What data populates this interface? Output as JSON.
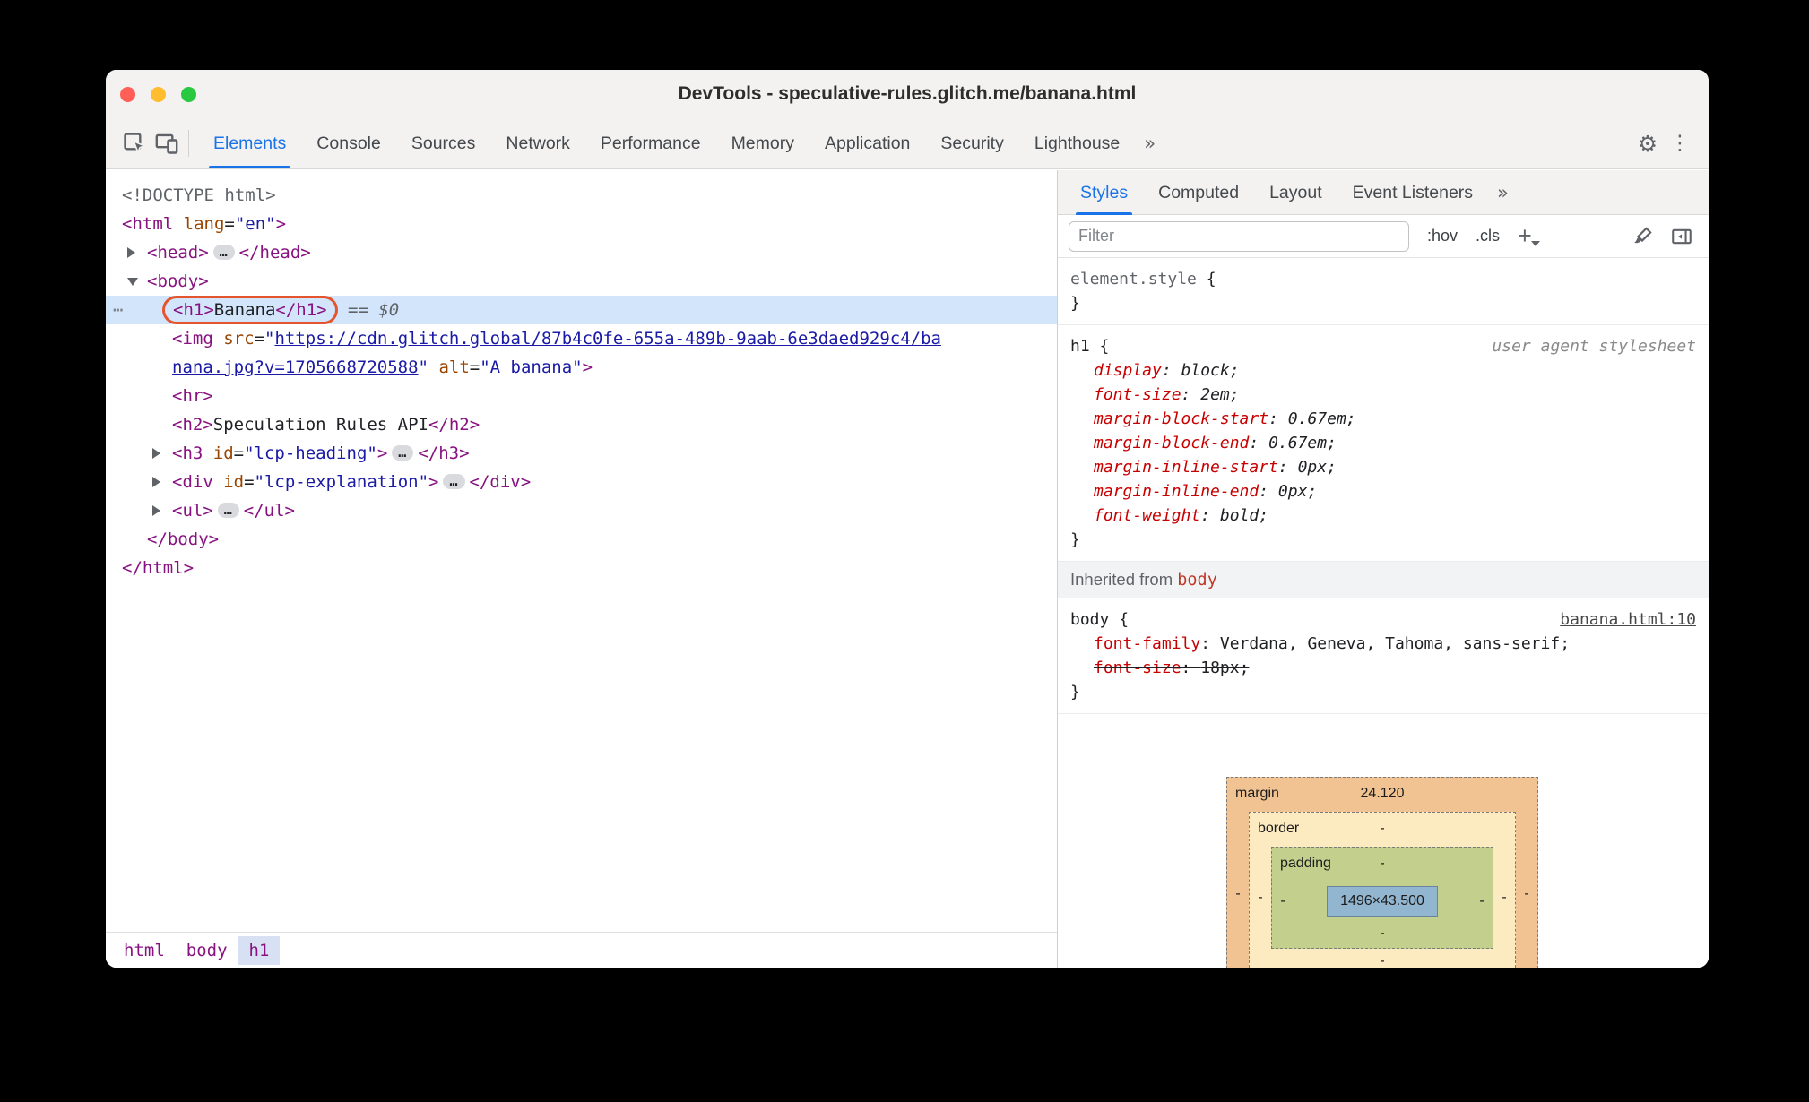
{
  "window": {
    "title": "DevTools - speculative-rules.glitch.me/banana.html"
  },
  "colors": {
    "accent_blue": "#1a73e8",
    "selection_bg": "#d3e5fb",
    "node_highlight_outline": "#e4552d",
    "tag": "#881280",
    "attr_name": "#994500",
    "attr_value": "#1a1aa6",
    "css_property": "#c80000",
    "traffic_close": "#ff5f57",
    "traffic_min": "#febc2e",
    "traffic_zoom": "#28c840"
  },
  "icons": {
    "gear": "⚙",
    "kebab": "⋮",
    "overflow": "»"
  },
  "main_tabs": {
    "items": [
      {
        "label": "Elements",
        "active": true
      },
      {
        "label": "Console"
      },
      {
        "label": "Sources"
      },
      {
        "label": "Network"
      },
      {
        "label": "Performance"
      },
      {
        "label": "Memory"
      },
      {
        "label": "Application"
      },
      {
        "label": "Security"
      },
      {
        "label": "Lighthouse"
      }
    ],
    "overflow": "»"
  },
  "dom": {
    "lines": [
      {
        "indent": 0,
        "tokens": [
          {
            "c": "doctype",
            "t": "<!DOCTYPE html>"
          }
        ]
      },
      {
        "indent": 0,
        "tokens": [
          {
            "c": "tag",
            "t": "<html"
          },
          {
            "c": "attr",
            "t": " lang"
          },
          {
            "c": "plain",
            "t": "="
          },
          {
            "c": "val",
            "t": "\"en\""
          },
          {
            "c": "tag",
            "t": ">"
          }
        ]
      },
      {
        "indent": 1,
        "arrow": "right",
        "tokens": [
          {
            "c": "tag",
            "t": "<head>"
          },
          {
            "c": "pill",
            "t": "…"
          },
          {
            "c": "tag",
            "t": "</head>"
          }
        ]
      },
      {
        "indent": 1,
        "arrow": "down",
        "tokens": [
          {
            "c": "tag",
            "t": "<body>"
          }
        ]
      },
      {
        "indent": 2,
        "selected": true,
        "gutter": "⋯",
        "tokens": [
          {
            "c": "outline",
            "tokens": [
              {
                "c": "tag",
                "t": "<h1>"
              },
              {
                "c": "plain",
                "t": "Banana"
              },
              {
                "c": "tag",
                "t": "</h1>"
              }
            ]
          },
          {
            "c": "marker",
            "t": " == $0"
          }
        ]
      },
      {
        "indent": 2,
        "tokens": [
          {
            "c": "tag",
            "t": "<img"
          },
          {
            "c": "attr",
            "t": " src"
          },
          {
            "c": "plain",
            "t": "="
          },
          {
            "c": "val",
            "t": "\""
          },
          {
            "c": "link",
            "t": "https://cdn.glitch.global/87b4c0fe-655a-489b-9aab-6e3daed929c4/ba"
          }
        ]
      },
      {
        "indent": 2,
        "tokens": [
          {
            "c": "link",
            "t": "nana.jpg?v=1705668720588"
          },
          {
            "c": "val",
            "t": "\""
          },
          {
            "c": "attr",
            "t": " alt"
          },
          {
            "c": "plain",
            "t": "="
          },
          {
            "c": "val",
            "t": "\"A banana\""
          },
          {
            "c": "tag",
            "t": ">"
          }
        ]
      },
      {
        "indent": 2,
        "tokens": [
          {
            "c": "tag",
            "t": "<hr>"
          }
        ]
      },
      {
        "indent": 2,
        "tokens": [
          {
            "c": "tag",
            "t": "<h2>"
          },
          {
            "c": "plain",
            "t": "Speculation Rules API"
          },
          {
            "c": "tag",
            "t": "</h2>"
          }
        ]
      },
      {
        "indent": 2,
        "arrow": "right",
        "tokens": [
          {
            "c": "tag",
            "t": "<h3"
          },
          {
            "c": "attr",
            "t": " id"
          },
          {
            "c": "plain",
            "t": "="
          },
          {
            "c": "val",
            "t": "\"lcp-heading\""
          },
          {
            "c": "tag",
            "t": ">"
          },
          {
            "c": "pill",
            "t": "…"
          },
          {
            "c": "tag",
            "t": "</h3>"
          }
        ]
      },
      {
        "indent": 2,
        "arrow": "right",
        "tokens": [
          {
            "c": "tag",
            "t": "<div"
          },
          {
            "c": "attr",
            "t": " id"
          },
          {
            "c": "plain",
            "t": "="
          },
          {
            "c": "val",
            "t": "\"lcp-explanation\""
          },
          {
            "c": "tag",
            "t": ">"
          },
          {
            "c": "pill",
            "t": "…"
          },
          {
            "c": "tag",
            "t": "</div>"
          }
        ]
      },
      {
        "indent": 2,
        "arrow": "right",
        "tokens": [
          {
            "c": "tag",
            "t": "<ul>"
          },
          {
            "c": "pill",
            "t": "…"
          },
          {
            "c": "tag",
            "t": "</ul>"
          }
        ]
      },
      {
        "indent": 1,
        "tokens": [
          {
            "c": "tag",
            "t": "</body>"
          }
        ]
      },
      {
        "indent": 0,
        "tokens": [
          {
            "c": "tag",
            "t": "</html>"
          }
        ]
      }
    ],
    "breadcrumbs": [
      {
        "label": "html"
      },
      {
        "label": "body"
      },
      {
        "label": "h1",
        "active": true
      }
    ]
  },
  "styles": {
    "tabs": [
      {
        "label": "Styles",
        "active": true
      },
      {
        "label": "Computed"
      },
      {
        "label": "Layout"
      },
      {
        "label": "Event Listeners"
      }
    ],
    "overflow": "»",
    "toolbar": {
      "filter_placeholder": "Filter",
      "pseudo_toggle": ":hov",
      "class_toggle": ".cls",
      "new_rule": "+"
    },
    "syntax": {
      "open": " {",
      "close": "}",
      "colon": ": ",
      "semi": ";"
    },
    "rules": [
      {
        "selector": "element.style",
        "selector_gray": true,
        "props": []
      },
      {
        "selector": "h1",
        "origin": "user agent stylesheet",
        "italic": true,
        "props": [
          {
            "name": "display",
            "value": "block"
          },
          {
            "name": "font-size",
            "value": "2em"
          },
          {
            "name": "margin-block-start",
            "value": "0.67em"
          },
          {
            "name": "margin-block-end",
            "value": "0.67em"
          },
          {
            "name": "margin-inline-start",
            "value": "0px"
          },
          {
            "name": "margin-inline-end",
            "value": "0px"
          },
          {
            "name": "font-weight",
            "value": "bold"
          }
        ]
      },
      {
        "header": "Inherited from ",
        "header_link": "body"
      },
      {
        "selector": "body",
        "source": "banana.html:10",
        "props": [
          {
            "name": "font-family",
            "value": "Verdana, Geneva, Tahoma, sans-serif"
          },
          {
            "name": "font-size",
            "value": "18px",
            "struck": true
          }
        ]
      }
    ]
  },
  "box_model": {
    "margin": {
      "label": "margin",
      "top": "24.120",
      "left": "-",
      "right": "-",
      "bottom": "-"
    },
    "border": {
      "label": "border",
      "top": "-",
      "left": "-",
      "right": "-",
      "bottom": "-"
    },
    "padding": {
      "label": "padding",
      "top": "-",
      "left": "-",
      "right": "-",
      "bottom": "-"
    },
    "content": "1496×43.500"
  }
}
